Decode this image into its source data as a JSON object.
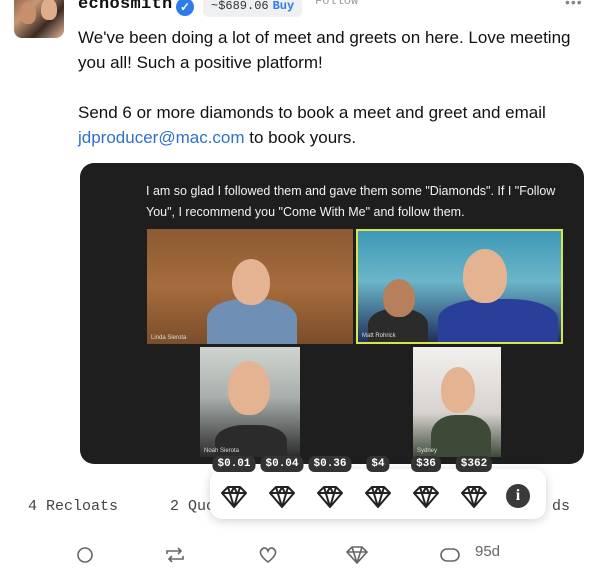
{
  "post": {
    "username": "echosmith",
    "price": "~$689.06",
    "buy_label": "Buy",
    "follow_label": "Follow",
    "more_label": "•••",
    "text_line1": "We've been doing a lot of meet and greets on here. Love meeting you all! Such a positive platform!",
    "text_line2_before": "Send 6 or more diamonds to book a meet and greet and email ",
    "email": "jdproducer@mac.com",
    "text_line2_after": " to book yours."
  },
  "media": {
    "caption": "I am so glad I followed them and gave them some \"Diamonds\". If I \"Follow You\", I recommend you \"Come With Me\" and follow them.",
    "tiles": [
      {
        "name": "Linda Sierota"
      },
      {
        "name": "Matt Rohrick"
      },
      {
        "name": "Noah Sierota"
      },
      {
        "name": "Sydney"
      }
    ]
  },
  "stats": {
    "recloats": "4 Recloats",
    "quotes_partial": "2 Quo",
    "diamonds_partial": "ds"
  },
  "actions": {
    "timestamp": "95d"
  },
  "tip_options": [
    {
      "price": "$0.01"
    },
    {
      "price": "$0.04"
    },
    {
      "price": "$0.36"
    },
    {
      "price": "$4"
    },
    {
      "price": "$36"
    },
    {
      "price": "$362"
    }
  ],
  "colors": {
    "link": "#2f6fd0",
    "verified": "#2f7be8",
    "tile_highlight": "#d7e64a"
  }
}
